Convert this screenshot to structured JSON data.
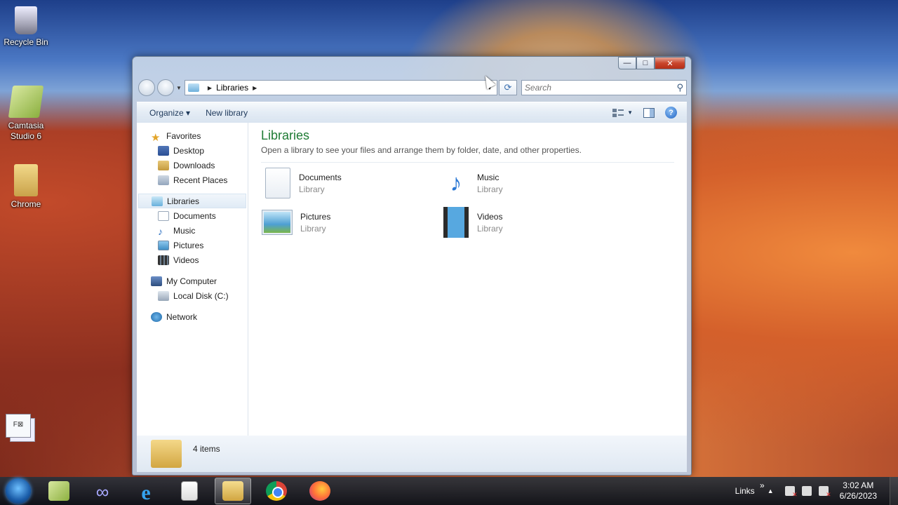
{
  "desktop": {
    "icons": [
      {
        "label": "Recycle Bin",
        "icon": "recycle-bin-icon"
      },
      {
        "label": "Camtasia Studio 6",
        "icon": "camtasia-icon"
      },
      {
        "label": "Chrome",
        "icon": "folder-icon"
      }
    ],
    "mini_window_glyph": "F⊠"
  },
  "window": {
    "caption": {
      "minimize": "—",
      "maximize": "□",
      "close": "✕"
    },
    "address": {
      "crumb": "Libraries"
    },
    "search": {
      "placeholder": "Search"
    },
    "toolbar": {
      "organize": "Organize ▾",
      "new_library": "New library",
      "help": "?"
    },
    "nav": {
      "favorites": "Favorites",
      "favorites_items": [
        "Desktop",
        "Downloads",
        "Recent Places"
      ],
      "libraries": "Libraries",
      "libraries_items": [
        "Documents",
        "Music",
        "Pictures",
        "Videos"
      ],
      "computer": "My Computer",
      "computer_items": [
        "Local Disk (C:)"
      ],
      "network": "Network"
    },
    "main": {
      "title": "Libraries",
      "description": "Open a library to see your files and arrange them by folder, date, and other properties.",
      "libraries": [
        {
          "name": "Documents",
          "type": "Library",
          "icon": "documents-icon"
        },
        {
          "name": "Music",
          "type": "Library",
          "icon": "music-icon"
        },
        {
          "name": "Pictures",
          "type": "Library",
          "icon": "pictures-icon"
        },
        {
          "name": "Videos",
          "type": "Library",
          "icon": "videos-icon"
        }
      ]
    },
    "details": {
      "count": "4 items"
    }
  },
  "taskbar": {
    "apps": [
      "camtasia",
      "infinity-app",
      "internet-explorer",
      "notepad",
      "windows-explorer",
      "chrome",
      "firefox"
    ],
    "tray": {
      "links": "Links",
      "links_chevron": "»",
      "time": "3:02 AM",
      "date": "6/26/2023"
    }
  }
}
